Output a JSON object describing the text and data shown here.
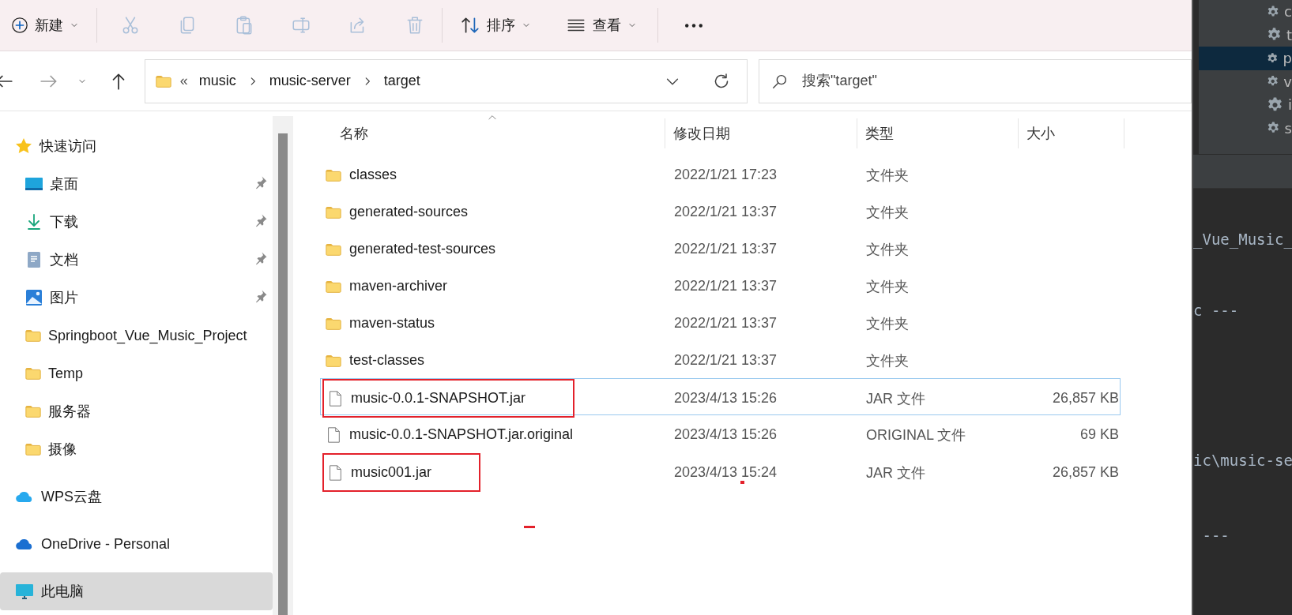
{
  "toolbar": {
    "new": {
      "label": "新建"
    },
    "actions": [
      {
        "kind": "cut",
        "disabled": true
      },
      {
        "kind": "copy",
        "disabled": true
      },
      {
        "kind": "paste",
        "disabled": true
      },
      {
        "kind": "rename",
        "disabled": true
      },
      {
        "kind": "share",
        "disabled": true
      },
      {
        "kind": "delete",
        "disabled": true
      }
    ],
    "sort": {
      "label": "排序"
    },
    "view": {
      "label": "查看"
    }
  },
  "navigation": {
    "back": {
      "disabled": false
    },
    "forward": {
      "disabled": true
    }
  },
  "address_bar": {
    "overflow": "«",
    "path": [
      "music",
      "music-server",
      "target"
    ]
  },
  "search": {
    "placeholder": "搜索\"target\""
  },
  "sidebar": {
    "items": [
      {
        "label": "快速访问",
        "kind": "star",
        "selected": false,
        "children": [
          {
            "label": "桌面",
            "kind": "desktop",
            "pinned": true,
            "selected": false
          },
          {
            "label": "下载",
            "kind": "download",
            "pinned": true,
            "selected": false
          },
          {
            "label": "文档",
            "kind": "document",
            "pinned": true,
            "selected": false
          },
          {
            "label": "图片",
            "kind": "pictures",
            "pinned": true,
            "selected": false
          },
          {
            "label": "Springboot_Vue_Music_Project",
            "kind": "folder",
            "pinned": false,
            "selected": false
          },
          {
            "label": "Temp",
            "kind": "folder",
            "pinned": false,
            "selected": false
          },
          {
            "label": "服务器",
            "kind": "folder",
            "pinned": false,
            "selected": false
          },
          {
            "label": "摄像",
            "kind": "folder",
            "pinned": false,
            "selected": false
          }
        ]
      },
      {
        "label": "WPS云盘",
        "kind": "wps-cloud",
        "selected": false
      },
      {
        "label": "OneDrive - Personal",
        "kind": "onedrive",
        "selected": false
      },
      {
        "label": "此电脑",
        "kind": "pc",
        "selected": true
      }
    ]
  },
  "file_list": {
    "columns": [
      {
        "label": "名称",
        "sorted": true
      },
      {
        "label": "修改日期",
        "sorted": false
      },
      {
        "label": "类型",
        "sorted": false
      },
      {
        "label": "大小",
        "sorted": false
      }
    ],
    "rows": [
      {
        "name": "classes",
        "kind": "folder",
        "date": "2022/1/21 17:23",
        "type": "文件夹",
        "focused": false,
        "annotated": false
      },
      {
        "name": "generated-sources",
        "kind": "folder",
        "date": "2022/1/21 13:37",
        "type": "文件夹",
        "focused": false,
        "annotated": false
      },
      {
        "name": "generated-test-sources",
        "kind": "folder",
        "date": "2022/1/21 13:37",
        "type": "文件夹",
        "focused": false,
        "annotated": false
      },
      {
        "name": "maven-archiver",
        "kind": "folder",
        "date": "2022/1/21 13:37",
        "type": "文件夹",
        "focused": false,
        "annotated": false
      },
      {
        "name": "maven-status",
        "kind": "folder",
        "date": "2022/1/21 13:37",
        "type": "文件夹",
        "focused": false,
        "annotated": false
      },
      {
        "name": "test-classes",
        "kind": "folder",
        "date": "2022/1/21 13:37",
        "type": "文件夹",
        "focused": false,
        "annotated": false
      },
      {
        "name": "music-0.0.1-SNAPSHOT.jar",
        "kind": "file",
        "date": "2023/4/13 15:26",
        "type": "JAR 文件",
        "size": "26,857 KB",
        "focused": true,
        "annotated": true
      },
      {
        "name": "music-0.0.1-SNAPSHOT.jar.original",
        "kind": "file",
        "date": "2023/4/13 15:26",
        "type": "ORIGINAL 文件",
        "size": "69 KB",
        "focused": false,
        "annotated": false
      },
      {
        "name": "music001.jar",
        "kind": "file",
        "date": "2023/4/13 15:24",
        "type": "JAR 文件",
        "size": "26,857 KB",
        "focused": false,
        "annotated": true
      }
    ]
  },
  "ide": {
    "tree_items": [
      {
        "label": "c",
        "selected": false
      },
      {
        "label": "t",
        "selected": false
      },
      {
        "label": "p",
        "selected": true
      },
      {
        "label": "v",
        "selected": false
      },
      {
        "label": "i",
        "selected": false
      },
      {
        "label": "s",
        "selected": false
      }
    ],
    "console_lines": [
      "_Vue_Music_",
      "c ---",
      "ic\\music-se",
      " ---"
    ]
  }
}
